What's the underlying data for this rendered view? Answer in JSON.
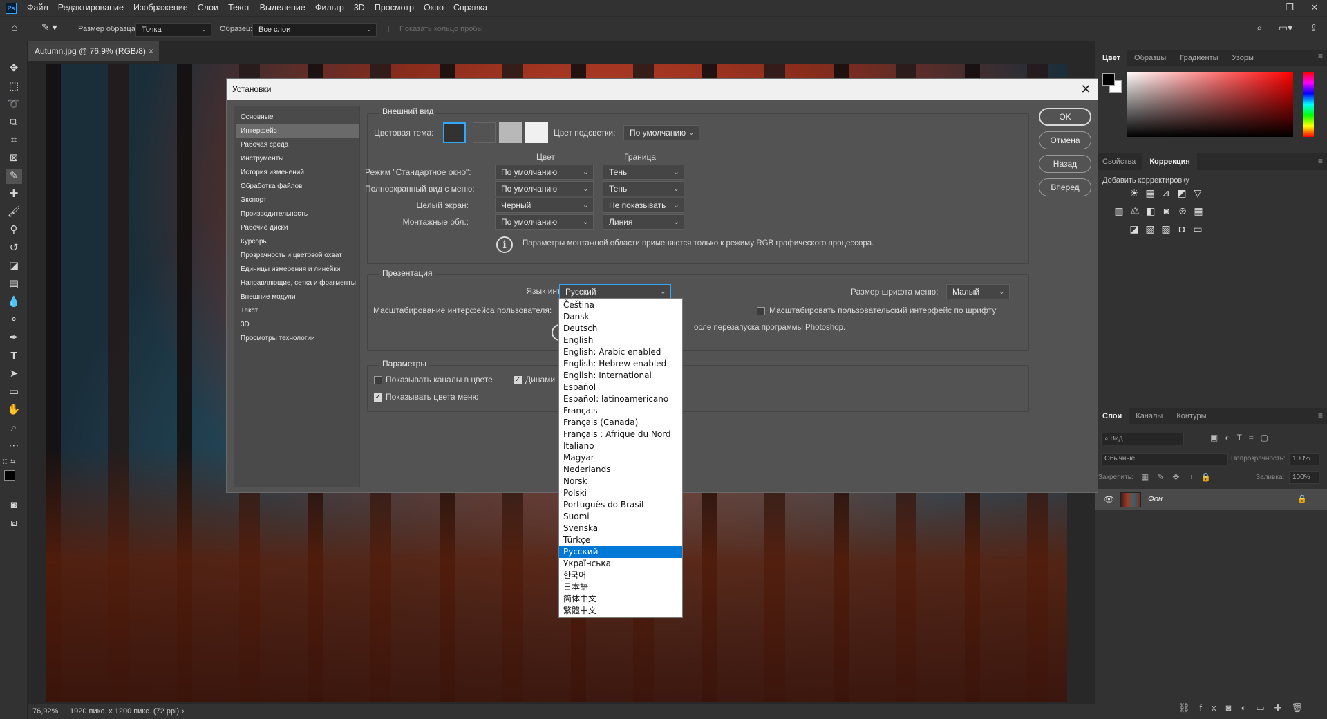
{
  "menubar": {
    "logo": "Ps",
    "items": [
      "Файл",
      "Редактирование",
      "Изображение",
      "Слои",
      "Текст",
      "Выделение",
      "Фильтр",
      "3D",
      "Просмотр",
      "Окно",
      "Справка"
    ]
  },
  "options": {
    "sample_size_label": "Размер образца:",
    "sample_size_value": "Точка",
    "sample_label": "Образец:",
    "sample_value": "Все слои",
    "sample_ring_label": "Показать кольцо пробы"
  },
  "document": {
    "tab_title": "Autumn.jpg @ 76,9% (RGB/8)",
    "zoom": "76,92%",
    "info": "1920 пикс. x 1200 пикс. (72 ppi)"
  },
  "panels": {
    "color_tabs": [
      "Цвет",
      "Образцы",
      "Градиенты",
      "Узоры"
    ],
    "adj_tabs": [
      "Свойства",
      "Коррекция"
    ],
    "adj_title": "Добавить корректировку",
    "layers_tabs": [
      "Слои",
      "Каналы",
      "Контуры"
    ],
    "layers_search": "Вид",
    "blend_mode": "Обычные",
    "opacity_label": "Непрозрачность:",
    "opacity_value": "100%",
    "lock_label": "Закрепить:",
    "fill_label": "Заливка:",
    "fill_value": "100%",
    "layer_name": "Фон",
    "colors": {
      "fg": "#000000",
      "bg": "#ffffff",
      "hue_top": "#ff0000"
    }
  },
  "dialog": {
    "title": "Установки",
    "nav": [
      "Основные",
      "Интерфейс",
      "Рабочая среда",
      "Инструменты",
      "История изменений",
      "Обработка файлов",
      "Экспорт",
      "Производительность",
      "Рабочие диски",
      "Курсоры",
      "Прозрачность и цветовой охват",
      "Единицы измерения и линейки",
      "Направляющие, сетка и фрагменты",
      "Внешние модули",
      "Текст",
      "3D",
      "Просмотры технологии"
    ],
    "nav_active": 1,
    "buttons": {
      "ok": "OK",
      "cancel": "Отмена",
      "back": "Назад",
      "forward": "Вперед"
    },
    "appearance": {
      "title": "Внешний вид",
      "color_theme_label": "Цветовая тема:",
      "highlight_label": "Цвет подсветки:",
      "highlight_value": "По умолчанию",
      "col_color": "Цвет",
      "col_border": "Граница",
      "rows": [
        {
          "label": "Режим \"Стандартное окно\":",
          "color": "По умолчанию",
          "border": "Тень"
        },
        {
          "label": "Полноэкранный вид с меню:",
          "color": "По умолчанию",
          "border": "Тень"
        },
        {
          "label": "Целый экран:",
          "color": "Черный",
          "border": "Не показывать"
        },
        {
          "label": "Монтажные обл.:",
          "color": "По умолчанию",
          "border": "Линия"
        }
      ],
      "note": "Параметры монтажной области применяются только к режиму RGB графического процессора."
    },
    "presentation": {
      "title": "Презентация",
      "lang_label": "Язык интерфейса:",
      "lang_value": "Русский",
      "font_size_label": "Размер шрифта меню:",
      "font_size_value": "Малый",
      "ui_scale_label": "Масштабирование интерфейса пользователя:",
      "scale_by_font_label": "Масштабировать пользовательский интерфейс по шрифту",
      "restart_note": "осле перезапуска программы Photoshop."
    },
    "params": {
      "title": "Параметры",
      "show_channels_color": "Показывать каналы в цвете",
      "dynamic": "Динами",
      "show_menu_colors": "Показывать цвета меню"
    },
    "languages": [
      "Čeština",
      "Dansk",
      "Deutsch",
      "English",
      "English: Arabic enabled",
      "English: Hebrew enabled",
      "English: International",
      "Español",
      "Español: latinoamericano",
      "Français",
      "Français (Canada)",
      "Français : Afrique du Nord",
      "Italiano",
      "Magyar",
      "Nederlands",
      "Norsk",
      "Polski",
      "Português do Brasil",
      "Suomi",
      "Svenska",
      "Türkçe",
      "Русский",
      "Українська",
      "한국어",
      "日本語",
      "简体中文",
      "繁體中文"
    ],
    "languages_selected": 21
  }
}
